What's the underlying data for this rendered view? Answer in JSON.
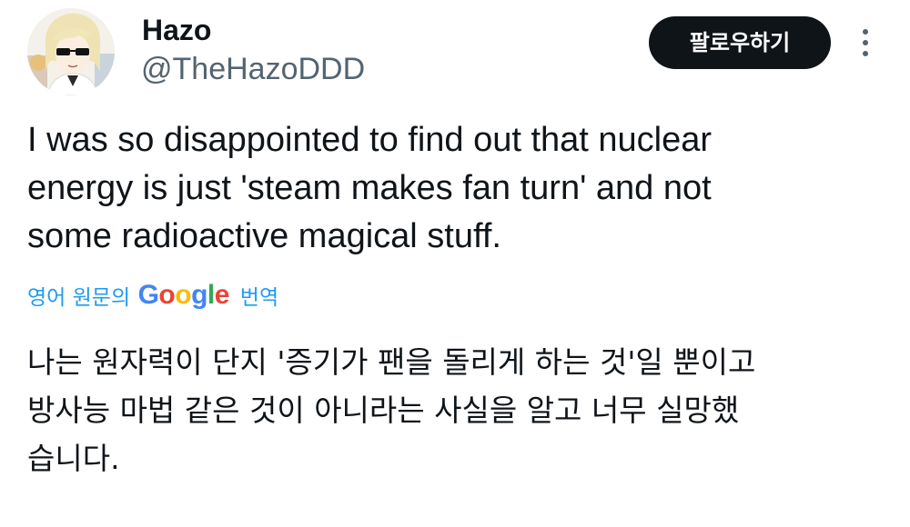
{
  "author": {
    "display_name": "Hazo",
    "handle": "@TheHazoDDD"
  },
  "actions": {
    "follow_label": "팔로우하기"
  },
  "tweet": {
    "lines": [
      "I was so disappointed to find out that nuclear",
      "energy is just 'steam makes fan turn' and not",
      "some radioactive magical stuff."
    ]
  },
  "translation": {
    "prefix": "영어 원문의",
    "google_letters": [
      "G",
      "o",
      "o",
      "g",
      "l",
      "e"
    ],
    "google_colors": [
      "#4285F4",
      "#EA4335",
      "#FBBC05",
      "#4285F4",
      "#34A853",
      "#EA4335"
    ],
    "suffix": "번역",
    "lines": [
      "나는 원자력이 단지 '증기가 팬을 돌리게 하는 것'일 뿐이고",
      "방사능 마법 같은 것이 아니라는 사실을 알고 너무 실망했",
      "습니다."
    ]
  },
  "colors": {
    "text_primary": "#0f1419",
    "text_secondary": "#536471",
    "link": "#1d9bf0",
    "button_bg": "#0f1419",
    "button_text": "#ffffff"
  },
  "icons": {
    "more": "more-vertical-icon"
  }
}
